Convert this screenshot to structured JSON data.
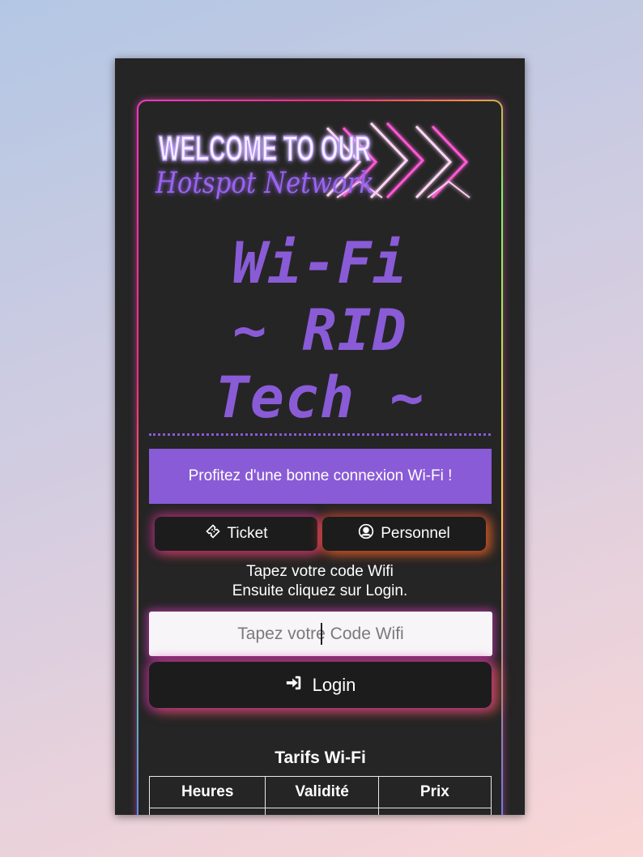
{
  "banner": {
    "title_line1": "WELCOME TO OUR",
    "title_line2": "Hotspot Network"
  },
  "heading": {
    "line1": "Wi-Fi",
    "line2": "~ RID",
    "line3": "Tech ~"
  },
  "promo": {
    "text": "Profitez d'une bonne connexion Wi-Fi !"
  },
  "tabs": [
    {
      "label": "Ticket",
      "icon": "ticket-icon"
    },
    {
      "label": "Personnel",
      "icon": "user-circle-icon"
    }
  ],
  "instructions": {
    "line1": "Tapez votre code Wifi",
    "line2": "Ensuite cliquez sur Login."
  },
  "code_input": {
    "placeholder": "Tapez votre Code Wifi",
    "value": ""
  },
  "login": {
    "label": "Login",
    "icon": "sign-in-icon"
  },
  "tarifs": {
    "title": "Tarifs Wi-Fi",
    "columns": [
      "Heures",
      "Validité",
      "Prix"
    ]
  },
  "colors": {
    "accent": "#8a5bd6",
    "card_bg": "#252525",
    "button_bg": "#1c1c1c"
  }
}
